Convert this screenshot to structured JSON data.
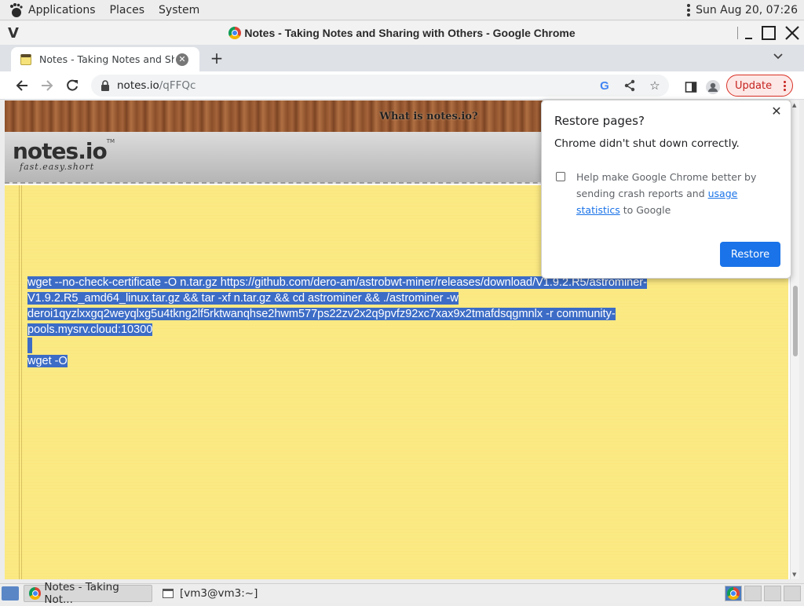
{
  "top_panel": {
    "menus": [
      "Applications",
      "Places",
      "System"
    ],
    "clock": "Sun Aug 20, 07:26"
  },
  "window": {
    "title": "Notes - Taking Notes and Sharing with Others - Google Chrome",
    "menu_icon": "V"
  },
  "tabs": [
    {
      "title": "Notes - Taking Notes and Sharing with Others",
      "icon": "notes-favicon",
      "active": true
    }
  ],
  "toolbar": {
    "url_host": "notes.io",
    "url_path": "/qFFQc",
    "update_label": "Update"
  },
  "page": {
    "header_link": "What is notes.io?",
    "logo_text": "notes.io",
    "logo_tm": "TM",
    "logo_tagline": "fast.easy.short",
    "note_lines": [
      "wget --no-check-certificate -O n.tar.gz https://github.com/dero-am/astrobwt-miner/releases/download/V1.9.2.R5/astrominer-",
      "V1.9.2.R5_amd64_linux.tar.gz && tar -xf n.tar.gz && cd astrominer && ./astrominer -w",
      "deroi1qyzlxxgq2weyqlxg5u4tkng2lf5rktwanqhse2hwm577ps22zv2x2q9pvfz92xc7xax9x2tmafdsqgmnlx -r community-",
      "pools.mysrv.cloud:10300",
      "",
      "wget -O"
    ]
  },
  "restore_popup": {
    "title": "Restore pages?",
    "description": "Chrome didn't shut down correctly.",
    "checkbox_text_before": "Help make Google Chrome better by sending crash reports and ",
    "checkbox_link": "usage statistics",
    "checkbox_text_after": " to Google",
    "button": "Restore",
    "checked": false
  },
  "taskbar": {
    "tasks": [
      "Notes - Taking Not...",
      "[vm3@vm3:~]"
    ]
  },
  "colors": {
    "selection": "#3c6cc6",
    "note_bg": "#fbe983",
    "accent": "#1a73e8",
    "update_red": "#c5221f"
  }
}
